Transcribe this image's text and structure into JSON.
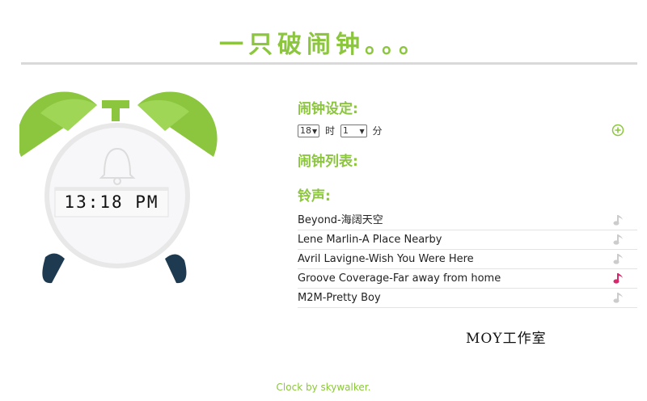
{
  "title": "一只破闹钟。。。",
  "clock": {
    "time": "13:18 PM",
    "colors": {
      "bell_green": "#8cc63f",
      "feet": "#1e3a50",
      "face": "#f2f2f2"
    }
  },
  "settings": {
    "heading": "闹钟设定:",
    "hour_value": "18",
    "hour_unit": "时",
    "minute_value": "1",
    "minute_unit": "分",
    "add_icon": "plus-circle-icon"
  },
  "alarm_list": {
    "heading": "闹钟列表:"
  },
  "ringtones": {
    "heading": "铃声:",
    "items": [
      {
        "label": "Beyond-海阔天空",
        "active": false
      },
      {
        "label": "Lene Marlin-A Place Nearby",
        "active": false
      },
      {
        "label": "Avril Lavigne-Wish You Were Here",
        "active": false
      },
      {
        "label": "Groove Coverage-Far away from home",
        "active": true
      },
      {
        "label": "M2M-Pretty Boy",
        "active": false
      }
    ],
    "note_color_inactive": "#cccccc",
    "note_color_active": "#d6286a"
  },
  "studio": "MOY工作室",
  "footer": "Clock by skywalker."
}
